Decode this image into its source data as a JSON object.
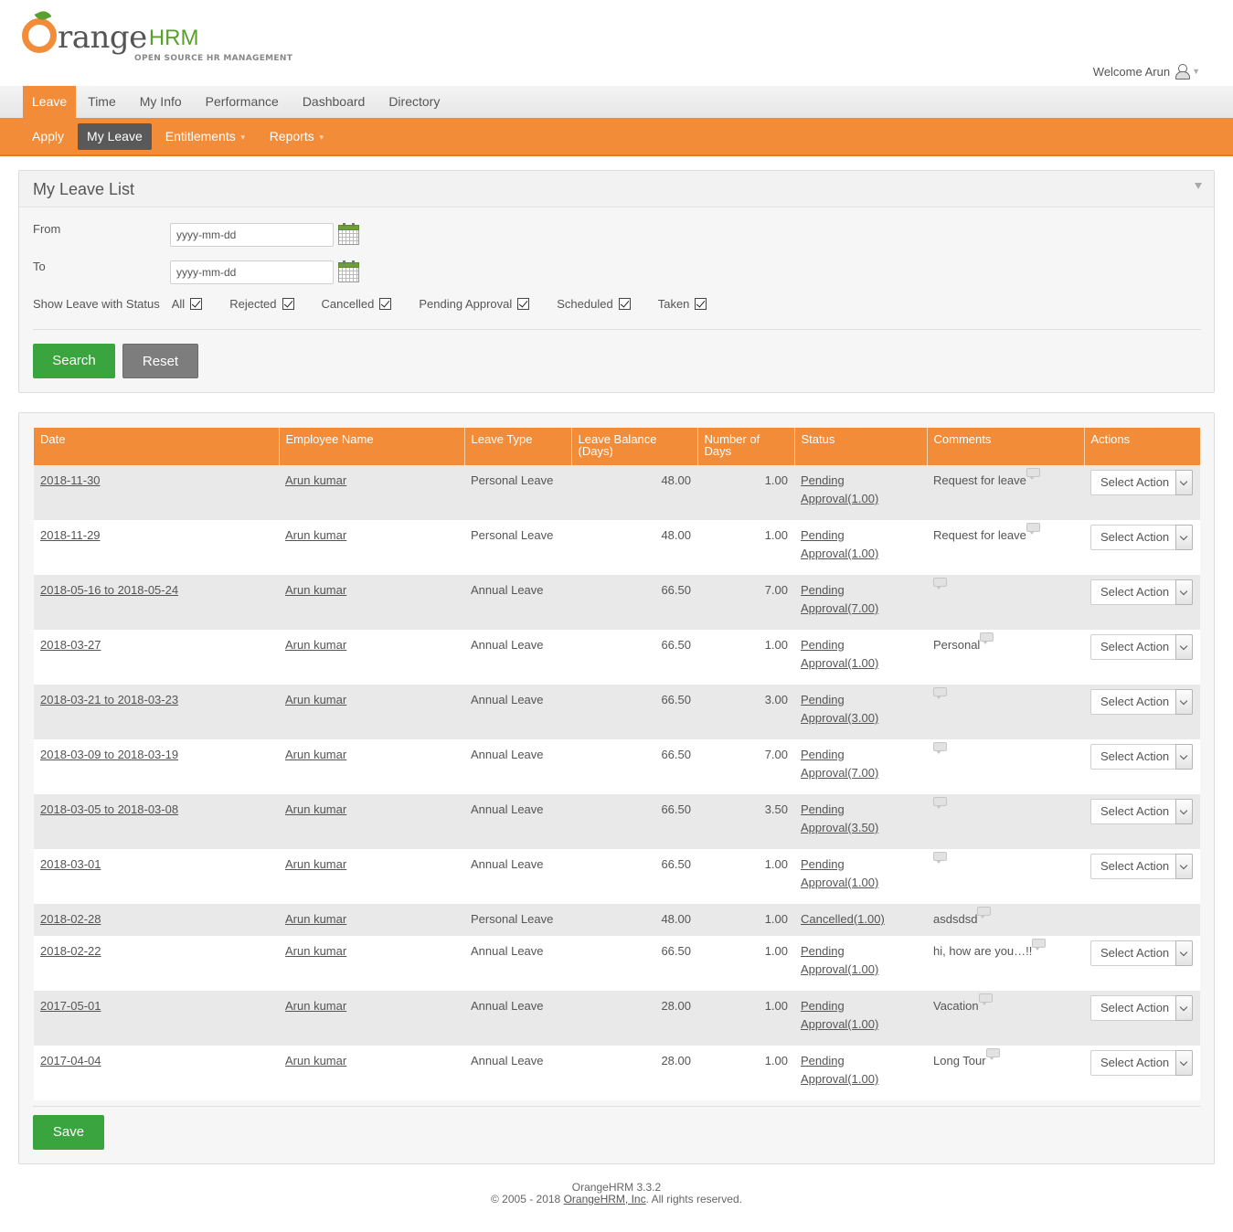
{
  "header": {
    "logo_text": "range",
    "logo_hrm": "HRM",
    "logo_subtitle": "OPEN SOURCE HR MANAGEMENT",
    "welcome": "Welcome Arun"
  },
  "topmenu": {
    "items": [
      "Leave",
      "Time",
      "My Info",
      "Performance",
      "Dashboard",
      "Directory"
    ],
    "active": "Leave"
  },
  "submenu": {
    "items": [
      "Apply",
      "My Leave",
      "Entitlements",
      "Reports"
    ],
    "active": "My Leave"
  },
  "filter": {
    "title": "My Leave List",
    "from_label": "From",
    "to_label": "To",
    "from_value": "yyyy-mm-dd",
    "to_value": "yyyy-mm-dd",
    "status_label": "Show Leave with Status",
    "statuses": [
      {
        "label": "All",
        "checked": true
      },
      {
        "label": "Rejected",
        "checked": true
      },
      {
        "label": "Cancelled",
        "checked": true
      },
      {
        "label": "Pending Approval",
        "checked": true
      },
      {
        "label": "Scheduled",
        "checked": true
      },
      {
        "label": "Taken",
        "checked": true
      }
    ],
    "search_button": "Search",
    "reset_button": "Reset"
  },
  "table": {
    "headers": [
      "Date",
      "Employee Name",
      "Leave Type",
      "Leave Balance (Days)",
      "Number of Days",
      "Status",
      "Comments",
      "Actions"
    ],
    "select_action_label": "Select Action",
    "rows": [
      {
        "date": "2018-11-30",
        "employee": "Arun kumar",
        "type": "Personal Leave",
        "balance": "48.00",
        "days": "1.00",
        "status1": "Pending",
        "status2": "Approval(1.00)",
        "comment": "Request for leave",
        "action": true
      },
      {
        "date": "2018-11-29",
        "employee": "Arun kumar",
        "type": "Personal Leave",
        "balance": "48.00",
        "days": "1.00",
        "status1": "Pending",
        "status2": "Approval(1.00)",
        "comment": "Request for leave",
        "action": true
      },
      {
        "date": "2018-05-16 to 2018-05-24",
        "employee": "Arun kumar",
        "type": "Annual Leave",
        "balance": "66.50",
        "days": "7.00",
        "status1": "Pending",
        "status2": "Approval(7.00)",
        "comment": "",
        "action": true
      },
      {
        "date": "2018-03-27",
        "employee": "Arun kumar",
        "type": "Annual Leave",
        "balance": "66.50",
        "days": "1.00",
        "status1": "Pending",
        "status2": "Approval(1.00)",
        "comment": "Personal",
        "action": true
      },
      {
        "date": "2018-03-21 to 2018-03-23",
        "employee": "Arun kumar",
        "type": "Annual Leave",
        "balance": "66.50",
        "days": "3.00",
        "status1": "Pending",
        "status2": "Approval(3.00)",
        "comment": "",
        "action": true
      },
      {
        "date": "2018-03-09 to 2018-03-19",
        "employee": "Arun kumar",
        "type": "Annual Leave",
        "balance": "66.50",
        "days": "7.00",
        "status1": "Pending",
        "status2": "Approval(7.00)",
        "comment": "",
        "action": true
      },
      {
        "date": "2018-03-05 to 2018-03-08",
        "employee": "Arun kumar",
        "type": "Annual Leave",
        "balance": "66.50",
        "days": "3.50",
        "status1": "Pending",
        "status2": "Approval(3.50)",
        "comment": "",
        "action": true
      },
      {
        "date": "2018-03-01",
        "employee": "Arun kumar",
        "type": "Annual Leave",
        "balance": "66.50",
        "days": "1.00",
        "status1": "Pending",
        "status2": "Approval(1.00)",
        "comment": "",
        "action": true
      },
      {
        "date": "2018-02-28",
        "employee": "Arun kumar",
        "type": "Personal Leave",
        "balance": "48.00",
        "days": "1.00",
        "status1": "Cancelled(1.00)",
        "status2": "",
        "comment": "asdsdsd",
        "action": false
      },
      {
        "date": "2018-02-22",
        "employee": "Arun kumar",
        "type": "Annual Leave",
        "balance": "66.50",
        "days": "1.00",
        "status1": "Pending",
        "status2": "Approval(1.00)",
        "comment": "hi, how are you…!!",
        "action": true
      },
      {
        "date": "2017-05-01",
        "employee": "Arun kumar",
        "type": "Annual Leave",
        "balance": "28.00",
        "days": "1.00",
        "status1": "Pending",
        "status2": "Approval(1.00)",
        "comment": "Vacation",
        "action": true
      },
      {
        "date": "2017-04-04",
        "employee": "Arun kumar",
        "type": "Annual Leave",
        "balance": "28.00",
        "days": "1.00",
        "status1": "Pending",
        "status2": "Approval(1.00)",
        "comment": "Long Tour",
        "action": true
      }
    ],
    "save_button": "Save"
  },
  "footer": {
    "version": "OrangeHRM 3.3.2",
    "copyright_prefix": "© 2005 - 2018 ",
    "company_link": "OrangeHRM, Inc",
    "copyright_suffix": ". All rights reserved."
  },
  "colors": {
    "accent": "#f28c38",
    "green": "#3aa53f",
    "logo_green": "#5aa02c"
  }
}
